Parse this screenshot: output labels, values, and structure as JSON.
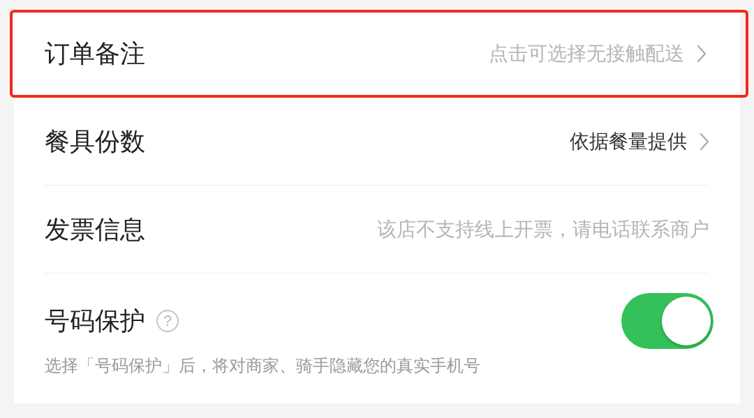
{
  "rows": [
    {
      "kind": "link",
      "label": "订单备注",
      "value": "点击可选择无接触配送",
      "value_muted": true,
      "highlighted": true
    },
    {
      "kind": "link",
      "label": "餐具份数",
      "value": "依据餐量提供",
      "value_muted": false,
      "highlighted": false
    },
    {
      "kind": "text",
      "label": "发票信息",
      "value": "该店不支持线上开票，请电话联系商户",
      "value_muted": true,
      "highlighted": false
    },
    {
      "kind": "toggle",
      "label": "号码保护",
      "help": "?",
      "on": true,
      "note": "选择「号码保护」后，将对商家、骑手隐藏您的真实手机号",
      "highlighted": false
    }
  ]
}
